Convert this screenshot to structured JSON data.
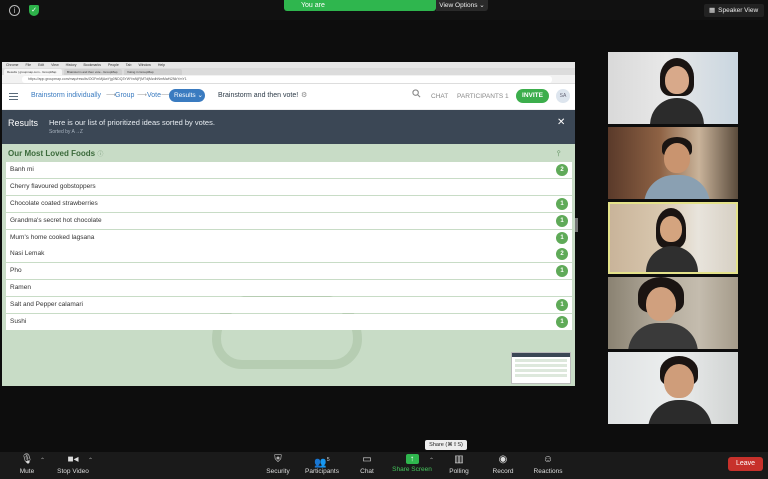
{
  "zoom": {
    "share_banner": "You are",
    "view_options": "View Options",
    "speaker_view": "Speaker View",
    "share_tooltip": "Share (⌘⇧S)",
    "toolbar": {
      "mute": "Mute",
      "stop_video": "Stop Video",
      "security": "Security",
      "participants": "Participants",
      "participants_count": "5",
      "chat": "Chat",
      "share_screen": "Share Screen",
      "polling": "Polling",
      "record": "Record",
      "reactions": "Reactions",
      "leave": "Leave"
    },
    "colors": {
      "share_green": "#2fb64e",
      "leave_red": "#c7312b",
      "active_speaker": "#e4e28a"
    }
  },
  "browser": {
    "menu": [
      "Chrome",
      "File",
      "Edit",
      "View",
      "History",
      "Bookmarks",
      "People",
      "Tab",
      "Window",
      "Help"
    ],
    "tabs": [
      "Results | groupmap.com - GroupMap",
      "Brainstorm and then vote - GroupMap",
      "Voting in GroupMap"
    ],
    "address": "https://app.groupmap.com/map/results/OGFmMjAwYjg0NDQ3YWYwNjFjMTdjMzdhNmMwN2NkYmY1"
  },
  "app": {
    "breadcrumb": [
      "Brainstorm individually",
      "Group",
      "Vote"
    ],
    "breadcrumb_active": "Results",
    "board_title": "Brainstorm and then vote!",
    "chat": "CHAT",
    "participants": "PARTICIPANTS 1",
    "invite": "INVITE",
    "user_initials": "SA",
    "results_bar": {
      "title": "Results",
      "text": "Here is our list of prioritized ideas sorted by votes.",
      "sub": "Sorted by A→Z"
    },
    "list_title": "Our Most Loved Foods",
    "items": [
      {
        "label": "Banh mi",
        "votes": "2"
      },
      {
        "label": "Cherry flavoured gobstoppers",
        "votes": ""
      },
      {
        "label": "Chocolate coated strawberries",
        "votes": "1"
      },
      {
        "label": "Grandma's secret hot chocolate",
        "votes": "1"
      },
      {
        "label": "Mum's home cooked lagsana",
        "votes": "1"
      },
      {
        "label": "Nasi Lemak",
        "votes": "2"
      },
      {
        "label": "Pho",
        "votes": "1"
      },
      {
        "label": "Ramen",
        "votes": ""
      },
      {
        "label": "Salt and Pepper calamari",
        "votes": "1"
      },
      {
        "label": "Sushi",
        "votes": "1"
      }
    ],
    "colors": {
      "accent": "#3a7bc0",
      "invite": "#3cae4c",
      "vote_badge": "#5faa58",
      "header_dark": "#3b4755",
      "list_bg": "#c8dcc6"
    }
  }
}
